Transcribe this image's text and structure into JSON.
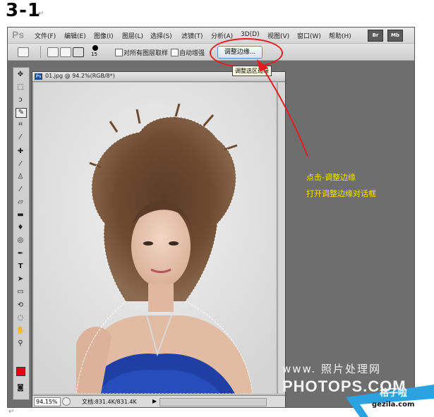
{
  "heading": "3-1",
  "paragraph_mark": "↵",
  "menu": {
    "logo": "Ps",
    "items": [
      "文件(F)",
      "编辑(E)",
      "图像(I)",
      "图层(L)",
      "选择(S)",
      "滤镜(T)",
      "分析(A)",
      "3D(D)",
      "视图(V)",
      "窗口(W)",
      "帮助(H)"
    ],
    "buttons": [
      "Br",
      "Mb"
    ]
  },
  "options_bar": {
    "brush_size": "15",
    "sample_all_layers": "对所有图层取样",
    "auto_enhance": "自动增强",
    "refine_edge_button": "调整边缘..."
  },
  "tooltip": "调整选区边缘",
  "document": {
    "title": "01.jpg @ 94.2%(RGB/8*)",
    "zoom": "94.15%",
    "doc_size": "文档:831.4K/831.4K",
    "ps_icon": "Ps"
  },
  "annotation": {
    "line1": "点击-调整边缘",
    "line2": "打开调整边缘对话框"
  },
  "watermark": {
    "text": "www.  照片处理网",
    "url": "PHOTOPS.COM"
  },
  "badge": {
    "name": "格子啦",
    "url": "gezila.com"
  },
  "colors": {
    "foreground": "#e60012",
    "background": "#ffffff",
    "annotation": "#f2e600",
    "highlight": "#e51d1d"
  }
}
